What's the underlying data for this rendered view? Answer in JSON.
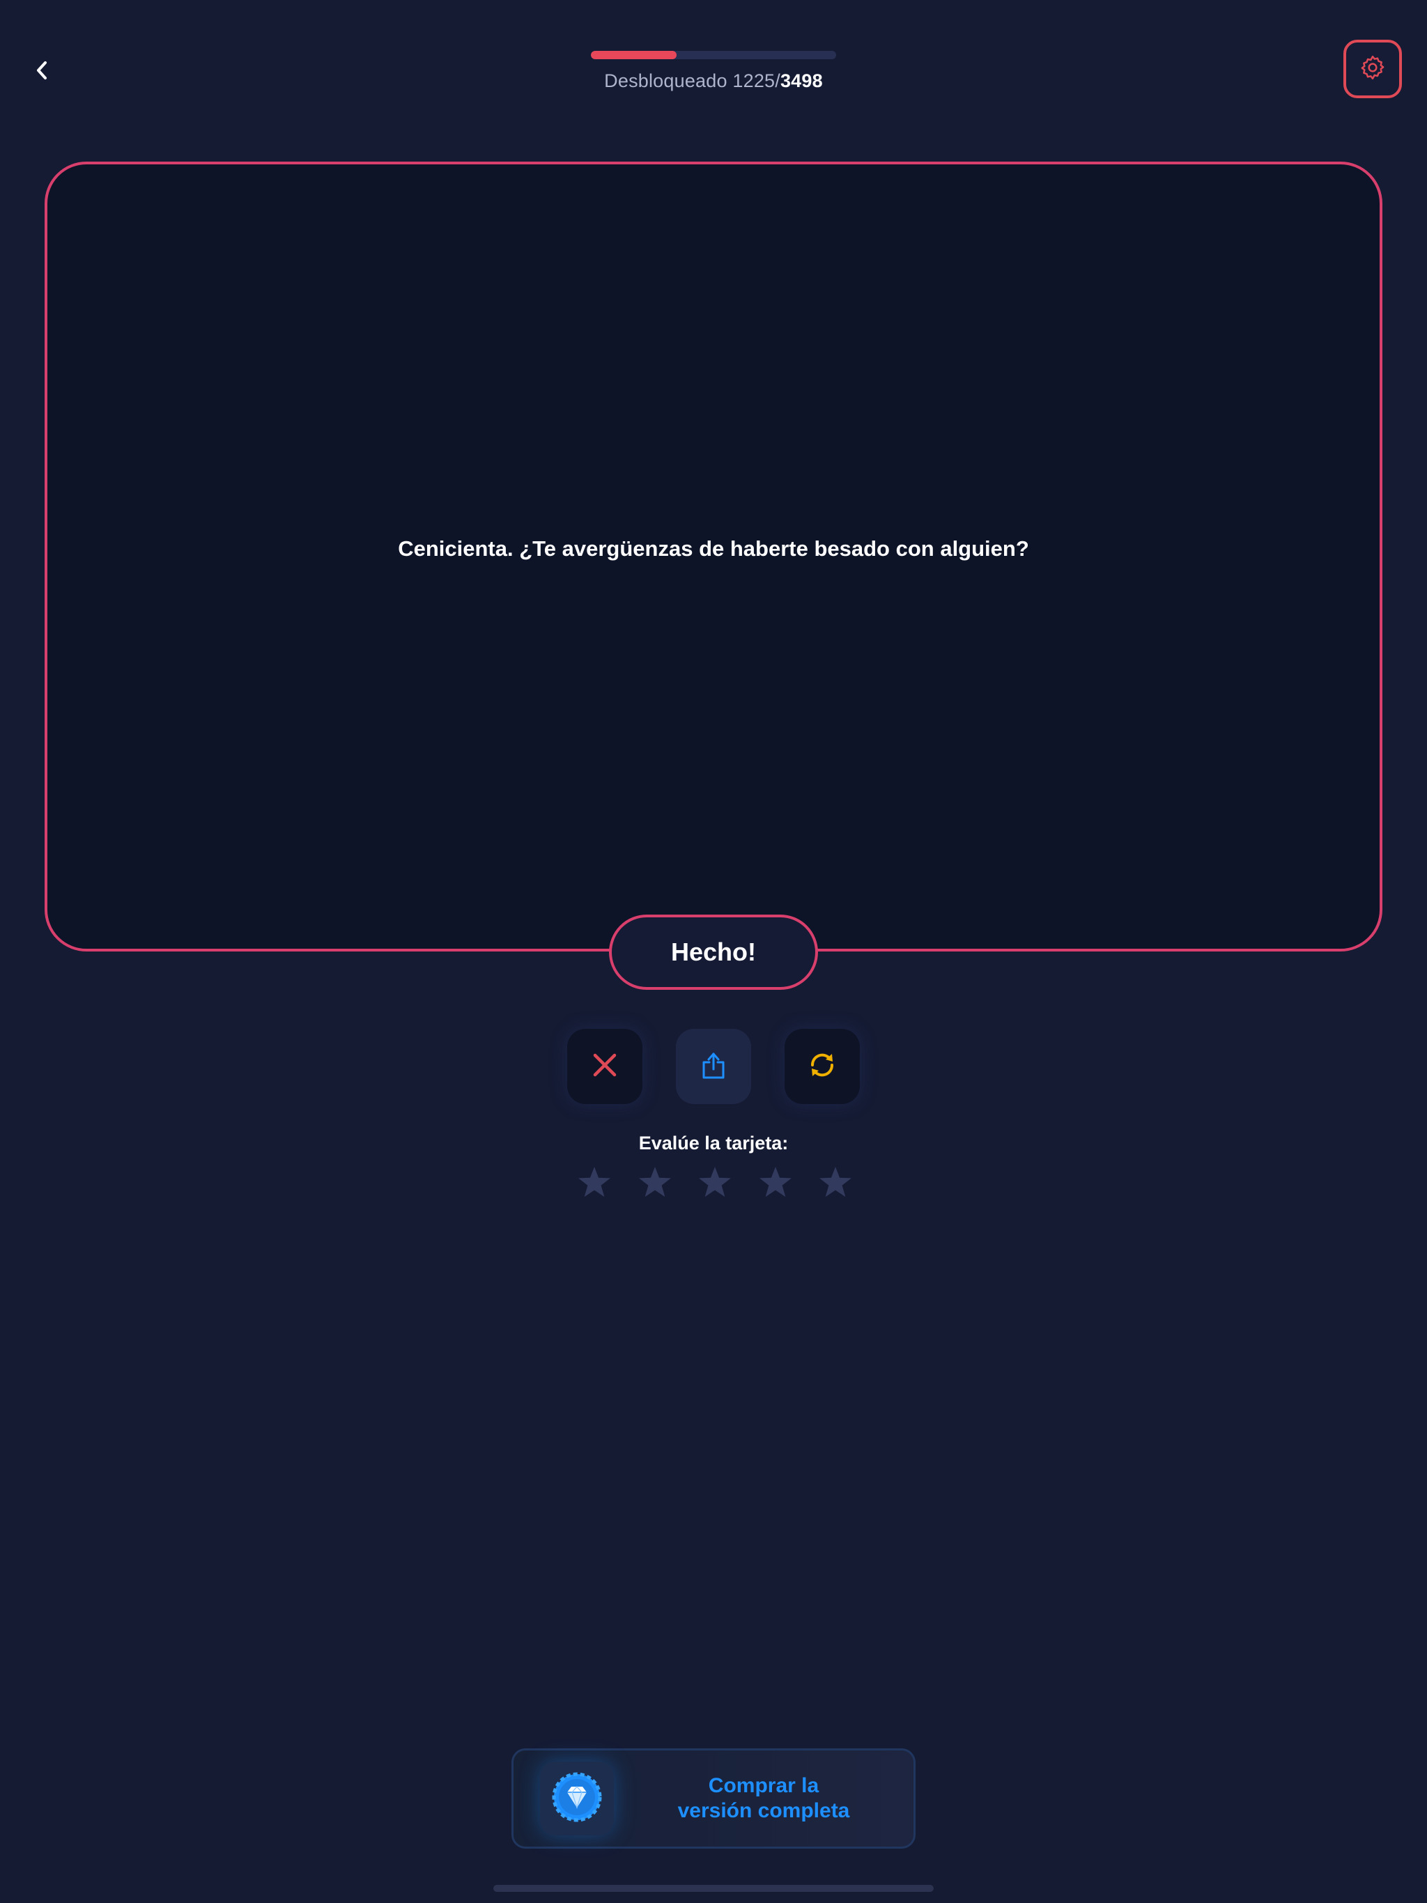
{
  "header": {
    "back_icon": "chevron-left-icon",
    "progress": {
      "label": "Desbloqueado 1225/",
      "unlocked": 1225,
      "total": "3498",
      "fraction": 0.35
    },
    "settings_icon": "gear-icon"
  },
  "card": {
    "text": "Cenicienta. ¿Te avergüenzas de haberte besado con alguien?",
    "done_label": "Hecho!"
  },
  "actions": {
    "dismiss_icon": "close-icon",
    "share_icon": "share-icon",
    "refresh_icon": "refresh-icon"
  },
  "rating": {
    "label": "Evalúe la tarjeta:",
    "stars": 5,
    "value": 0
  },
  "purchase": {
    "icon": "diamond-icon",
    "line1": "Comprar la",
    "line2": "versión completa"
  },
  "colors": {
    "background": "#151b33",
    "card_border": "#d83f6c",
    "progress_fill": "#e8485a",
    "dismiss": "#e04a57",
    "share": "#1e8fff",
    "refresh": "#f0b000",
    "star_empty": "#323a5e",
    "purchase_text": "#1e8fff"
  }
}
